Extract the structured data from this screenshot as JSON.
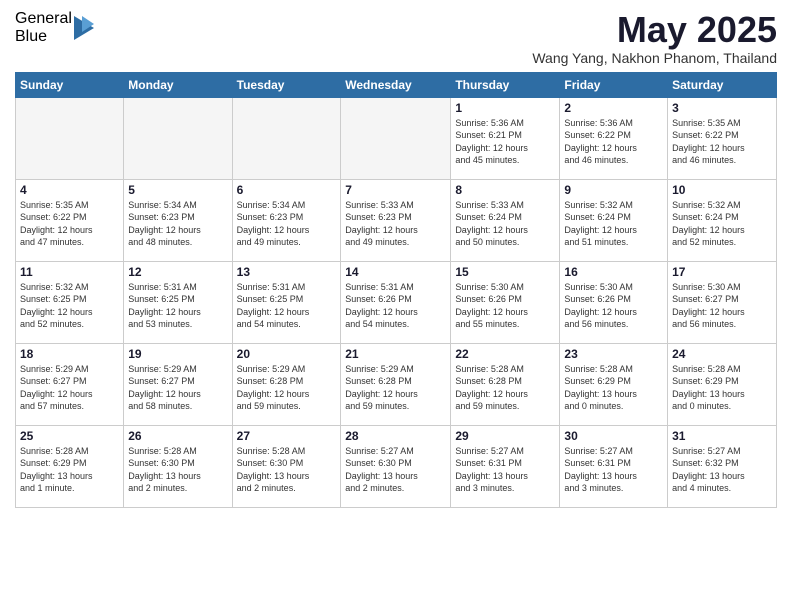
{
  "logo": {
    "general": "General",
    "blue": "Blue"
  },
  "title": "May 2025",
  "location": "Wang Yang, Nakhon Phanom, Thailand",
  "days_of_week": [
    "Sunday",
    "Monday",
    "Tuesday",
    "Wednesday",
    "Thursday",
    "Friday",
    "Saturday"
  ],
  "weeks": [
    [
      {
        "day": "",
        "info": ""
      },
      {
        "day": "",
        "info": ""
      },
      {
        "day": "",
        "info": ""
      },
      {
        "day": "",
        "info": ""
      },
      {
        "day": "1",
        "info": "Sunrise: 5:36 AM\nSunset: 6:21 PM\nDaylight: 12 hours\nand 45 minutes."
      },
      {
        "day": "2",
        "info": "Sunrise: 5:36 AM\nSunset: 6:22 PM\nDaylight: 12 hours\nand 46 minutes."
      },
      {
        "day": "3",
        "info": "Sunrise: 5:35 AM\nSunset: 6:22 PM\nDaylight: 12 hours\nand 46 minutes."
      }
    ],
    [
      {
        "day": "4",
        "info": "Sunrise: 5:35 AM\nSunset: 6:22 PM\nDaylight: 12 hours\nand 47 minutes."
      },
      {
        "day": "5",
        "info": "Sunrise: 5:34 AM\nSunset: 6:23 PM\nDaylight: 12 hours\nand 48 minutes."
      },
      {
        "day": "6",
        "info": "Sunrise: 5:34 AM\nSunset: 6:23 PM\nDaylight: 12 hours\nand 49 minutes."
      },
      {
        "day": "7",
        "info": "Sunrise: 5:33 AM\nSunset: 6:23 PM\nDaylight: 12 hours\nand 49 minutes."
      },
      {
        "day": "8",
        "info": "Sunrise: 5:33 AM\nSunset: 6:24 PM\nDaylight: 12 hours\nand 50 minutes."
      },
      {
        "day": "9",
        "info": "Sunrise: 5:32 AM\nSunset: 6:24 PM\nDaylight: 12 hours\nand 51 minutes."
      },
      {
        "day": "10",
        "info": "Sunrise: 5:32 AM\nSunset: 6:24 PM\nDaylight: 12 hours\nand 52 minutes."
      }
    ],
    [
      {
        "day": "11",
        "info": "Sunrise: 5:32 AM\nSunset: 6:25 PM\nDaylight: 12 hours\nand 52 minutes."
      },
      {
        "day": "12",
        "info": "Sunrise: 5:31 AM\nSunset: 6:25 PM\nDaylight: 12 hours\nand 53 minutes."
      },
      {
        "day": "13",
        "info": "Sunrise: 5:31 AM\nSunset: 6:25 PM\nDaylight: 12 hours\nand 54 minutes."
      },
      {
        "day": "14",
        "info": "Sunrise: 5:31 AM\nSunset: 6:26 PM\nDaylight: 12 hours\nand 54 minutes."
      },
      {
        "day": "15",
        "info": "Sunrise: 5:30 AM\nSunset: 6:26 PM\nDaylight: 12 hours\nand 55 minutes."
      },
      {
        "day": "16",
        "info": "Sunrise: 5:30 AM\nSunset: 6:26 PM\nDaylight: 12 hours\nand 56 minutes."
      },
      {
        "day": "17",
        "info": "Sunrise: 5:30 AM\nSunset: 6:27 PM\nDaylight: 12 hours\nand 56 minutes."
      }
    ],
    [
      {
        "day": "18",
        "info": "Sunrise: 5:29 AM\nSunset: 6:27 PM\nDaylight: 12 hours\nand 57 minutes."
      },
      {
        "day": "19",
        "info": "Sunrise: 5:29 AM\nSunset: 6:27 PM\nDaylight: 12 hours\nand 58 minutes."
      },
      {
        "day": "20",
        "info": "Sunrise: 5:29 AM\nSunset: 6:28 PM\nDaylight: 12 hours\nand 59 minutes."
      },
      {
        "day": "21",
        "info": "Sunrise: 5:29 AM\nSunset: 6:28 PM\nDaylight: 12 hours\nand 59 minutes."
      },
      {
        "day": "22",
        "info": "Sunrise: 5:28 AM\nSunset: 6:28 PM\nDaylight: 12 hours\nand 59 minutes."
      },
      {
        "day": "23",
        "info": "Sunrise: 5:28 AM\nSunset: 6:29 PM\nDaylight: 13 hours\nand 0 minutes."
      },
      {
        "day": "24",
        "info": "Sunrise: 5:28 AM\nSunset: 6:29 PM\nDaylight: 13 hours\nand 0 minutes."
      }
    ],
    [
      {
        "day": "25",
        "info": "Sunrise: 5:28 AM\nSunset: 6:29 PM\nDaylight: 13 hours\nand 1 minute."
      },
      {
        "day": "26",
        "info": "Sunrise: 5:28 AM\nSunset: 6:30 PM\nDaylight: 13 hours\nand 2 minutes."
      },
      {
        "day": "27",
        "info": "Sunrise: 5:28 AM\nSunset: 6:30 PM\nDaylight: 13 hours\nand 2 minutes."
      },
      {
        "day": "28",
        "info": "Sunrise: 5:27 AM\nSunset: 6:30 PM\nDaylight: 13 hours\nand 2 minutes."
      },
      {
        "day": "29",
        "info": "Sunrise: 5:27 AM\nSunset: 6:31 PM\nDaylight: 13 hours\nand 3 minutes."
      },
      {
        "day": "30",
        "info": "Sunrise: 5:27 AM\nSunset: 6:31 PM\nDaylight: 13 hours\nand 3 minutes."
      },
      {
        "day": "31",
        "info": "Sunrise: 5:27 AM\nSunset: 6:32 PM\nDaylight: 13 hours\nand 4 minutes."
      }
    ]
  ]
}
